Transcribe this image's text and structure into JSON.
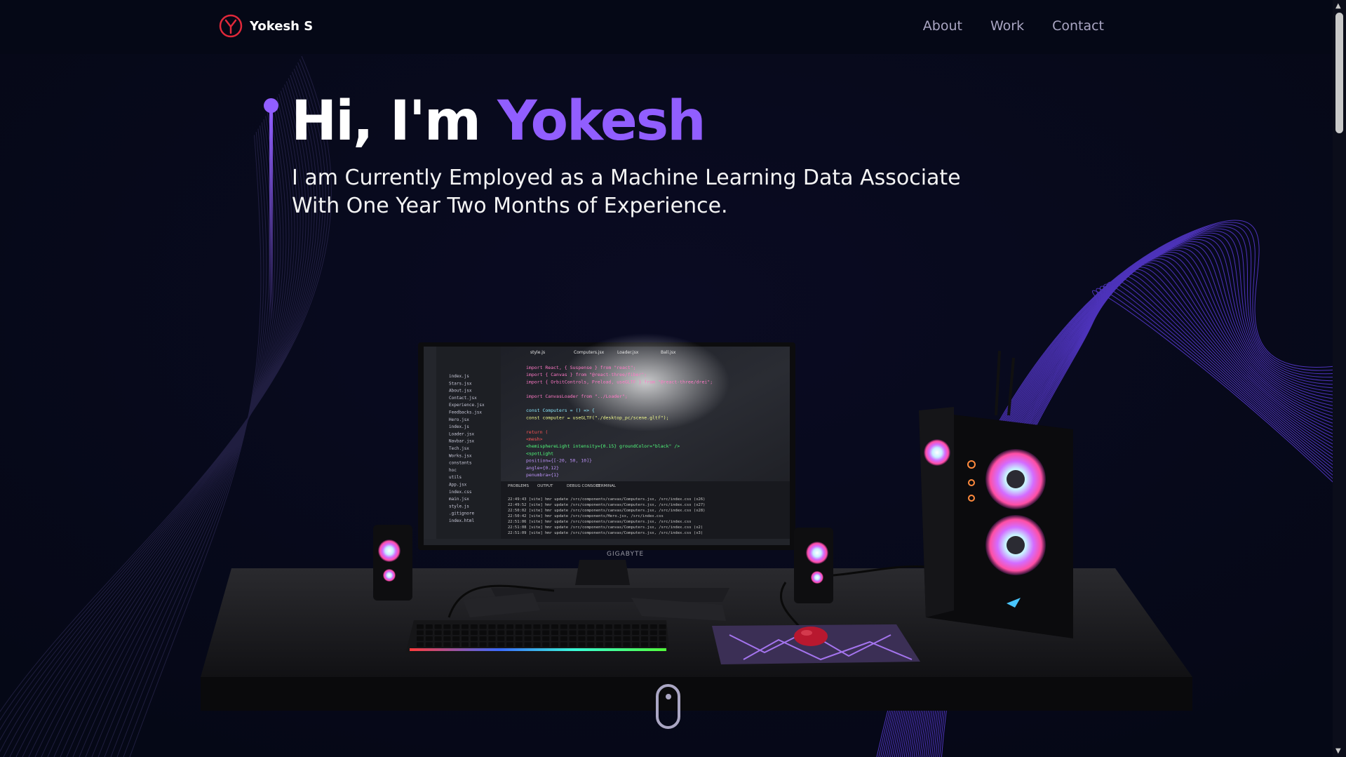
{
  "brand": {
    "name": "Yokesh S",
    "logo_icon": "y-circle-logo-icon",
    "logo_color": "#e0283a"
  },
  "nav": {
    "items": [
      {
        "label": "About"
      },
      {
        "label": "Work"
      },
      {
        "label": "Contact"
      }
    ]
  },
  "hero": {
    "greeting": "Hi, I'm ",
    "name": "Yokesh",
    "subtitle_line1": "I am Currently Employed as a Machine Learning Data Associate",
    "subtitle_line2": "With One Year Two Months of Experience."
  },
  "scene": {
    "monitor_brand": "GIGABYTE",
    "editor_tabs": [
      "style.js",
      "Computers.jsx",
      "Loader.jsx",
      "Ball.jsx"
    ],
    "terminal_tabs": [
      "PROBLEMS",
      "OUTPUT",
      "DEBUG CONSOLE",
      "TERMINAL"
    ],
    "code_lines": [
      "import React, { Suspense } from \"react\";",
      "import { Canvas } from \"@react-three/fiber\";",
      "import { OrbitControls, Preload, useGLTF } from \"@react-three/drei\";",
      "",
      "import CanvasLoader from \"../Loader\";",
      "",
      "const Computers = () => {",
      "  const computer = useGLTF(\"./desktop_pc/scene.gltf\");",
      "",
      "  return (",
      "    <mesh>",
      "      <hemisphereLight intensity={0.15} groundColor=\"black\" />",
      "      <spotLight",
      "        position={[-20, 50, 10]}",
      "        angle={0.12}",
      "        penumbra={1}"
    ],
    "terminal_lines": [
      "22:49:43 [vite] hmr update /src/components/canvas/Computers.jsx, /src/index.css (x26)",
      "22:49:52 [vite] hmr update /src/components/canvas/Computers.jsx, /src/index.css (x27)",
      "22:50:02 [vite] hmr update /src/components/canvas/Computers.jsx, /src/index.css (x28)",
      "22:50:42 [vite] hmr update /src/components/Hero.jsx, /src/index.css",
      "22:51:06 [vite] hmr update /src/components/canvas/Computers.jsx, /src/index.css",
      "22:51:08 [vite] hmr update /src/components/canvas/Computers.jsx, /src/index.css (x2)",
      "22:51:09 [vite] hmr update /src/components/canvas/Computers.jsx, /src/index.css (x3)"
    ],
    "explorer_files": [
      "index.js",
      "Stars.jsx",
      "About.jsx",
      "Contact.jsx",
      "Experience.jsx",
      "Feedbacks.jsx",
      "Hero.jsx",
      "index.js",
      "Loader.jsx",
      "Navbar.jsx",
      "Tech.jsx",
      "Works.jsx",
      "constants",
      "hoc",
      "utils",
      "App.jsx",
      "index.css",
      "main.jsx",
      "style.js",
      ".gitignore",
      "index.html"
    ]
  },
  "colors": {
    "accent": "#915eff",
    "background": "#050816",
    "secondary_text": "#aaa6c3"
  }
}
